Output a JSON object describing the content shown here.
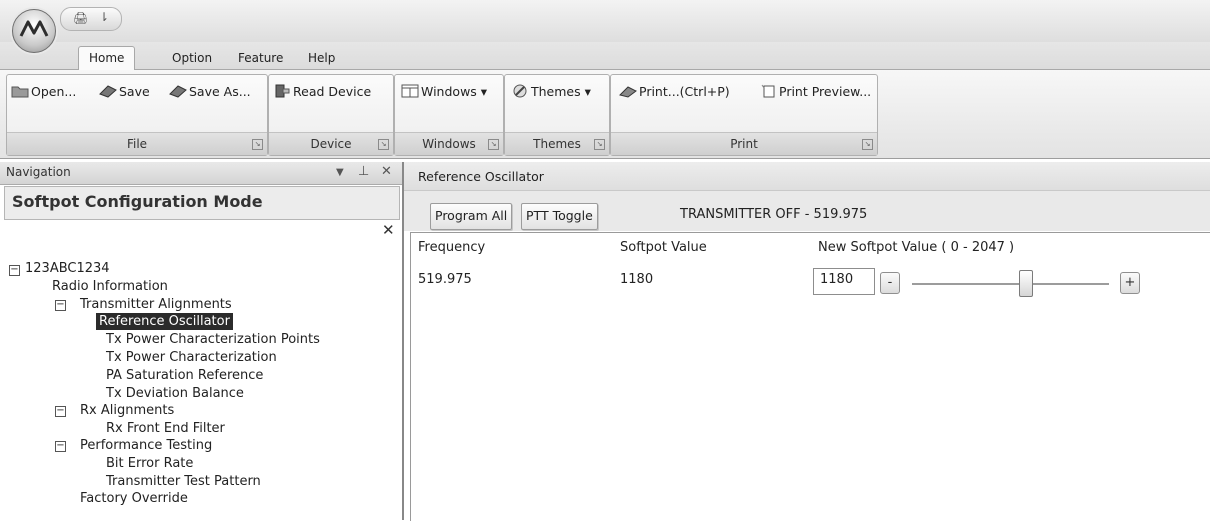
{
  "ribbon": {
    "tabs": [
      "Home",
      "Option",
      "Feature",
      "Help"
    ],
    "active_tab": "Home",
    "groups": {
      "file": {
        "label": "File",
        "open": "Open...",
        "save": "Save",
        "save_as": "Save As..."
      },
      "device": {
        "label": "Device",
        "read": "Read Device"
      },
      "windows": {
        "label": "Windows",
        "button": "Windows ▾"
      },
      "themes": {
        "label": "Themes",
        "button": "Themes ▾"
      },
      "print": {
        "label": "Print",
        "print": "Print...(Ctrl+P)",
        "preview": "Print Preview..."
      }
    }
  },
  "navigation": {
    "title": "Navigation",
    "mode": "Softpot Configuration Mode",
    "tree": {
      "root": "123ABC1234",
      "radio_info": "Radio Information",
      "tx_align": "Transmitter Alignments",
      "ref_osc": "Reference Oscillator",
      "tx_power_points": "Tx Power Characterization Points",
      "tx_power_char": "Tx Power Characterization",
      "pa_sat": "PA Saturation Reference",
      "tx_dev": "Tx Deviation Balance",
      "rx_align": "Rx Alignments",
      "rx_front": "Rx Front End Filter",
      "perf": "Performance Testing",
      "ber": "Bit Error Rate",
      "tx_pattern": "Transmitter Test Pattern",
      "factory": "Factory Override"
    }
  },
  "content": {
    "title": "Reference Oscillator",
    "program_all": "Program All",
    "ptt_toggle": "PTT Toggle",
    "status": "TRANSMITTER OFF - 519.975",
    "columns": {
      "frequency": "Frequency",
      "softpot": "Softpot Value",
      "new_softpot": "New Softpot Value ( 0 - 2047 )"
    },
    "row": {
      "frequency": "519.975",
      "softpot": "1180",
      "new_value": "1180"
    },
    "minus": "-",
    "plus": "+",
    "slider": {
      "min": 0,
      "max": 2047,
      "value": 1180
    }
  }
}
